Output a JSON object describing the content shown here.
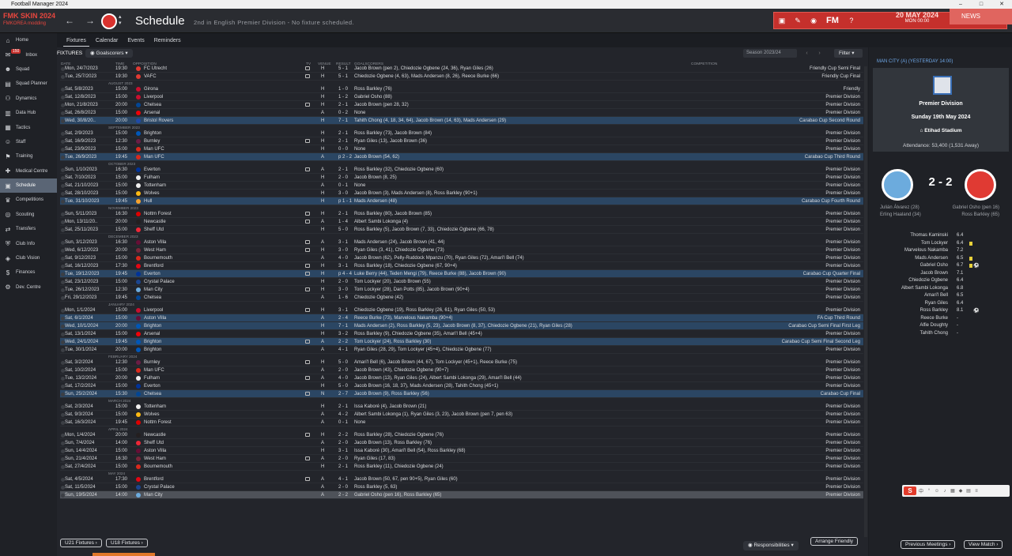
{
  "window": {
    "title": "Football Manager 2024",
    "min": "–",
    "max": "□",
    "close": "✕"
  },
  "topbar": {
    "skin_title": "FMK SKIN 2024",
    "skin_sub": "FMKOREA modding",
    "page_title": "Schedule",
    "page_subtitle": "2nd in English Premier Division - No fixture scheduled.",
    "date": "20 MAY 2024",
    "time": "MON 00:00",
    "news_label": "NEWS",
    "fm_logo": "FM",
    "accent_color": "#c5302c"
  },
  "sidebar": {
    "items": [
      {
        "label": "Home",
        "icon": "home-icon"
      },
      {
        "label": "Inbox",
        "icon": "inbox-icon",
        "badge": "150"
      },
      {
        "label": "Squad",
        "icon": "squad-icon"
      },
      {
        "label": "Squad Planner",
        "icon": "planner-icon"
      },
      {
        "label": "Dynamics",
        "icon": "dynamics-icon"
      },
      {
        "label": "Data Hub",
        "icon": "datahub-icon"
      },
      {
        "label": "Tactics",
        "icon": "tactics-icon"
      },
      {
        "label": "Staff",
        "icon": "staff-icon"
      },
      {
        "label": "Training",
        "icon": "training-icon"
      },
      {
        "label": "Medical Centre",
        "icon": "medical-icon"
      },
      {
        "label": "Schedule",
        "icon": "schedule-icon",
        "active": true
      },
      {
        "label": "Competitions",
        "icon": "competitions-icon"
      },
      {
        "label": "Scouting",
        "icon": "scouting-icon"
      },
      {
        "label": "Transfers",
        "icon": "transfers-icon"
      },
      {
        "label": "Club Info",
        "icon": "clubinfo-icon"
      },
      {
        "label": "Club Vision",
        "icon": "clubvision-icon"
      },
      {
        "label": "Finances",
        "icon": "finances-icon"
      },
      {
        "label": "Dev. Centre",
        "icon": "devcentre-icon"
      }
    ]
  },
  "subtabs": [
    "Fixtures",
    "Calendar",
    "Events",
    "Reminders"
  ],
  "toolbar": {
    "fixtures_label": "FIXTURES",
    "goalscorers": "Goalscorers",
    "season": "Season 2023/24",
    "filter": "Filter"
  },
  "columns": {
    "date": "DATE",
    "time": "TIME",
    "opposition": "OPPOSITION",
    "tv": "TV",
    "venue": "VENUE",
    "result": "RESULT",
    "goalscorers": "GOALSCORERS",
    "competition": "COMPETITION"
  },
  "fixtures": [
    {
      "type": "row",
      "date": "Mon, 24/7/2023",
      "time": "19:30",
      "opp": "FC Utrecht",
      "tv": true,
      "venue": "H",
      "result": "5 - 1",
      "scorers": "Jacob Brown (pen 2), Chiedozie Ogbene (24, 36), Ryan Giles (26)",
      "comp": "Friendly Cup Semi Final",
      "crest": "#e03a33"
    },
    {
      "type": "row",
      "date": "Tue, 25/7/2023",
      "time": "19:30",
      "opp": "VAFC",
      "tv": true,
      "venue": "H",
      "result": "5 - 1",
      "scorers": "Chiedozie Ogbene (4, 63), Mads Andersen (8, 26), Reece Burke (66)",
      "comp": "Friendly Cup Final",
      "crest": "#e03a33"
    },
    {
      "type": "group",
      "label": "AUGUST 2023"
    },
    {
      "type": "row",
      "date": "Sat, 5/8/2023",
      "time": "15:00",
      "opp": "Girona",
      "venue": "H",
      "result": "1 - 0",
      "scorers": "Ross Barkley (76)",
      "comp": "Friendly",
      "crest": "#c8102e"
    },
    {
      "type": "row",
      "date": "Sat, 12/8/2023",
      "time": "15:00",
      "opp": "Liverpool",
      "venue": "H",
      "result": "1 - 2",
      "scorers": "Gabriel Osho (88)",
      "comp": "Premier Division",
      "crest": "#c8102e"
    },
    {
      "type": "row",
      "date": "Mon, 21/8/2023",
      "time": "20:00",
      "opp": "Chelsea",
      "tv": true,
      "venue": "H",
      "result": "2 - 1",
      "scorers": "Jacob Brown (pen 28, 32)",
      "comp": "Premier Division",
      "crest": "#034694"
    },
    {
      "type": "row",
      "date": "Sat, 26/8/2023",
      "time": "15:00",
      "opp": "Arsenal",
      "venue": "A",
      "result": "0 - 2",
      "scorers": "None",
      "comp": "Premier Division",
      "crest": "#ef0107"
    },
    {
      "type": "row",
      "hl": true,
      "date": "Wed, 30/8/20..",
      "time": "20:00",
      "opp": "Bristol Rovers",
      "venue": "H",
      "result": "7 - 1",
      "scorers": "Tahith Chong (4, 18, 34, 64), Jacob Brown (14, 63), Mads Andersen (29)",
      "comp": "Carabao Cup Second Round",
      "crest": "#1f4aa8"
    },
    {
      "type": "group",
      "label": "SEPTEMBER 2023"
    },
    {
      "type": "row",
      "date": "Sat, 2/9/2023",
      "time": "15:00",
      "opp": "Brighton",
      "venue": "H",
      "result": "2 - 1",
      "scorers": "Ross Barkley (73), Jacob Brown (84)",
      "comp": "Premier Division",
      "crest": "#0057b8"
    },
    {
      "type": "row",
      "date": "Sat, 16/9/2023",
      "time": "12:30",
      "opp": "Burnley",
      "tv": true,
      "venue": "H",
      "result": "2 - 1",
      "scorers": "Ryan Giles (13), Jacob Brown (36)",
      "comp": "Premier Division",
      "crest": "#6c1d45"
    },
    {
      "type": "row",
      "date": "Sat, 23/9/2023",
      "time": "15:00",
      "opp": "Man UFC",
      "venue": "H",
      "result": "0 - 0",
      "scorers": "None",
      "comp": "Premier Division",
      "crest": "#da291c"
    },
    {
      "type": "row",
      "hl": true,
      "date": "Tue, 26/9/2023",
      "time": "19:45",
      "opp": "Man UFC",
      "venue": "A",
      "result": "p 2 - 2",
      "scorers": "Jacob Brown (54, 62)",
      "comp": "Carabao Cup Third Round",
      "crest": "#da291c"
    },
    {
      "type": "group",
      "label": "OCTOBER 2023"
    },
    {
      "type": "row",
      "date": "Sun, 1/10/2023",
      "time": "16:30",
      "opp": "Everton",
      "tv": true,
      "venue": "A",
      "result": "2 - 1",
      "scorers": "Ross Barkley (32), Chiedozie Ogbene (60)",
      "comp": "Premier Division",
      "crest": "#003399"
    },
    {
      "type": "row",
      "date": "Sat, 7/10/2023",
      "time": "15:00",
      "opp": "Fulham",
      "venue": "H",
      "result": "2 - 0",
      "scorers": "Jacob Brown (8, 25)",
      "comp": "Premier Division",
      "crest": "#eeeeee"
    },
    {
      "type": "row",
      "date": "Sat, 21/10/2023",
      "time": "15:00",
      "opp": "Tottenham",
      "venue": "A",
      "result": "0 - 1",
      "scorers": "None",
      "comp": "Premier Division",
      "crest": "#f0f0f0"
    },
    {
      "type": "row",
      "date": "Sat, 28/10/2023",
      "time": "15:00",
      "opp": "Wolves",
      "venue": "H",
      "result": "3 - 0",
      "scorers": "Jacob Brown (3), Mads Andersen (8), Ross Barkley (90+1)",
      "comp": "Premier Division",
      "crest": "#fdb913"
    },
    {
      "type": "row",
      "hl": true,
      "date": "Tue, 31/10/2023",
      "time": "19:45",
      "opp": "Hull",
      "venue": "H",
      "result": "p 1 - 1",
      "scorers": "Mads Andersen (48)",
      "comp": "Carabao Cup Fourth Round",
      "crest": "#f5a12d"
    },
    {
      "type": "group",
      "label": "NOVEMBER 2023"
    },
    {
      "type": "row",
      "date": "Sun, 5/11/2023",
      "time": "16:30",
      "opp": "Nottm Forest",
      "tv": true,
      "venue": "H",
      "result": "2 - 1",
      "scorers": "Ross Barkley (80), Jacob Brown (85)",
      "comp": "Premier Division",
      "crest": "#dd0000"
    },
    {
      "type": "row",
      "date": "Mon, 13/11/20..",
      "time": "20:00",
      "opp": "Newcastle",
      "tv": true,
      "venue": "A",
      "result": "1 - 4",
      "scorers": "Albert Sambi Lokonga (4)",
      "comp": "Premier Division",
      "crest": "#241f20"
    },
    {
      "type": "row",
      "date": "Sat, 25/11/2023",
      "time": "15:00",
      "opp": "Sheff Utd",
      "venue": "H",
      "result": "5 - 0",
      "scorers": "Ross Barkley (5), Jacob Brown (7, 33), Chiedozie Ogbene (66, 78)",
      "comp": "Premier Division",
      "crest": "#ee2737"
    },
    {
      "type": "group",
      "label": "DECEMBER 2023"
    },
    {
      "type": "row",
      "date": "Sun, 3/12/2023",
      "time": "16:30",
      "opp": "Aston Villa",
      "tv": true,
      "venue": "A",
      "result": "3 - 1",
      "scorers": "Mads Andersen (24), Jacob Brown (41, 44)",
      "comp": "Premier Division",
      "crest": "#670e36"
    },
    {
      "type": "row",
      "date": "Wed, 6/12/2023",
      "time": "20:00",
      "opp": "West Ham",
      "tv": true,
      "venue": "H",
      "result": "3 - 0",
      "scorers": "Ryan Giles (3, 41), Chiedozie Ogbene (73)",
      "comp": "Premier Division",
      "crest": "#7a263a"
    },
    {
      "type": "row",
      "date": "Sat, 9/12/2023",
      "time": "15:00",
      "opp": "Bournemouth",
      "venue": "A",
      "result": "4 - 0",
      "scorers": "Jacob Brown (62), Pelly-Ruddock Mpanzu (70), Ryan Giles (72), Amari'l Bell (74)",
      "comp": "Premier Division",
      "crest": "#da291c"
    },
    {
      "type": "row",
      "date": "Sat, 16/12/2023",
      "time": "17:30",
      "opp": "Brentford",
      "tv": true,
      "venue": "H",
      "result": "3 - 1",
      "scorers": "Ross Barkley (18), Chiedozie Ogbene (67, 90+4)",
      "comp": "Premier Division",
      "crest": "#e30613"
    },
    {
      "type": "row",
      "hl": true,
      "date": "Tue, 19/12/2023",
      "time": "19:45",
      "opp": "Everton",
      "tv": true,
      "venue": "H",
      "result": "p 4 - 4",
      "scorers": "Luke Berry (44), Teden Mengi (79), Reece Burke (88), Jacob Brown (90)",
      "comp": "Carabao Cup Quarter Final",
      "crest": "#003399"
    },
    {
      "type": "row",
      "date": "Sat, 23/12/2023",
      "time": "15:00",
      "opp": "Crystal Palace",
      "venue": "H",
      "result": "2 - 0",
      "scorers": "Tom Lockyer (20), Jacob Brown (55)",
      "comp": "Premier Division",
      "crest": "#1b458f"
    },
    {
      "type": "row",
      "date": "Tue, 26/12/2023",
      "time": "12:30",
      "opp": "Man City",
      "tv": true,
      "venue": "H",
      "result": "3 - 0",
      "scorers": "Tom Lockyer (28), Dan Potts (85), Jacob Brown (90+4)",
      "comp": "Premier Division",
      "crest": "#6cabdd"
    },
    {
      "type": "row",
      "date": "Fri, 29/12/2023",
      "time": "19:45",
      "opp": "Chelsea",
      "venue": "A",
      "result": "1 - 6",
      "scorers": "Chiedozie Ogbene (42)",
      "comp": "Premier Division",
      "crest": "#034694"
    },
    {
      "type": "group",
      "label": "JANUARY 2024"
    },
    {
      "type": "row",
      "date": "Mon, 1/1/2024",
      "time": "15:00",
      "opp": "Liverpool",
      "tv": true,
      "venue": "H",
      "result": "3 - 1",
      "scorers": "Chiedozie Ogbene (19), Ross Barkley (26, 61), Ryan Giles (50, 53)",
      "comp": "Premier Division",
      "crest": "#c8102e"
    },
    {
      "type": "row",
      "hl": true,
      "date": "Sat, 6/1/2024",
      "time": "15:00",
      "opp": "Aston Villa",
      "venue": "A",
      "result": "2 - 4",
      "scorers": "Reece Burke (73), Marvelous Nakamba (90+4)",
      "comp": "FA Cup Third Round",
      "crest": "#670e36"
    },
    {
      "type": "row",
      "hl": true,
      "date": "Wed, 10/1/2024",
      "time": "20:00",
      "opp": "Brighton",
      "venue": "H",
      "result": "7 - 1",
      "scorers": "Mads Andersen (2), Ross Barkley (5, 23), Jacob Brown (8, 37), Chiedozie Ogbene (21), Ryan Giles (28)",
      "comp": "Carabao Cup Semi Final First Leg",
      "crest": "#0057b8"
    },
    {
      "type": "row",
      "date": "Sat, 13/1/2024",
      "time": "15:00",
      "opp": "Arsenal",
      "venue": "H",
      "result": "3 - 2",
      "scorers": "Ross Barkley (9), Chiedozie Ogbene (35), Amari'l Bell (45+4)",
      "comp": "Premier Division",
      "crest": "#ef0107"
    },
    {
      "type": "row",
      "hl": true,
      "date": "Wed, 24/1/2024",
      "time": "19:45",
      "opp": "Brighton",
      "tv": true,
      "venue": "A",
      "result": "2 - 2",
      "scorers": "Tom Lockyer (24), Ross Barkley (30)",
      "comp": "Carabao Cup Semi Final Second Leg",
      "crest": "#0057b8"
    },
    {
      "type": "row",
      "date": "Tue, 30/1/2024",
      "time": "20:00",
      "opp": "Brighton",
      "venue": "A",
      "result": "4 - 1",
      "scorers": "Ryan Giles (28, 29), Tom Lockyer (45+4), Chiedozie Ogbene (77)",
      "comp": "Premier Division",
      "crest": "#0057b8"
    },
    {
      "type": "group",
      "label": "FEBRUARY 2024"
    },
    {
      "type": "row",
      "date": "Sat, 3/2/2024",
      "time": "12:30",
      "opp": "Burnley",
      "tv": true,
      "venue": "H",
      "result": "5 - 0",
      "scorers": "Amari'l Bell (6), Jacob Brown (44, 67), Tom Lockyer (45+1), Reece Burke (75)",
      "comp": "Premier Division",
      "crest": "#6c1d45"
    },
    {
      "type": "row",
      "date": "Sat, 10/2/2024",
      "time": "15:00",
      "opp": "Man UFC",
      "venue": "A",
      "result": "2 - 0",
      "scorers": "Jacob Brown (43), Chiedozie Ogbene (90+7)",
      "comp": "Premier Division",
      "crest": "#da291c"
    },
    {
      "type": "row",
      "date": "Tue, 13/2/2024",
      "time": "20:00",
      "opp": "Fulham",
      "tv": true,
      "venue": "A",
      "result": "4 - 0",
      "scorers": "Jacob Brown (13), Ryan Giles (24), Albert Sambi Lokonga (29), Amari'l Bell (44)",
      "comp": "Premier Division",
      "crest": "#eeeeee"
    },
    {
      "type": "row",
      "date": "Sat, 17/2/2024",
      "time": "15:00",
      "opp": "Everton",
      "venue": "H",
      "result": "5 - 0",
      "scorers": "Jacob Brown (16, 18, 37), Mads Andersen (28), Tahith Chong (45+1)",
      "comp": "Premier Division",
      "crest": "#003399"
    },
    {
      "type": "row",
      "hl": true,
      "date": "Sun, 25/2/2024",
      "time": "15:30",
      "opp": "Chelsea",
      "tv": true,
      "venue": "N",
      "result": "2 - 7",
      "scorers": "Jacob Brown (9), Ross Barkley (56)",
      "comp": "Carabao Cup Final",
      "crest": "#034694"
    },
    {
      "type": "group",
      "label": "MARCH 2024"
    },
    {
      "type": "row",
      "date": "Sat, 2/3/2024",
      "time": "15:00",
      "opp": "Tottenham",
      "venue": "H",
      "result": "2 - 1",
      "scorers": "Issa Kaboré (4), Jacob Brown (21)",
      "comp": "Premier Division",
      "crest": "#f0f0f0"
    },
    {
      "type": "row",
      "date": "Sat, 9/3/2024",
      "time": "15:00",
      "opp": "Wolves",
      "venue": "A",
      "result": "4 - 2",
      "scorers": "Albert Sambi Lokonga (1), Ryan Giles (3, 23), Jacob Brown (pen 7, pen 63)",
      "comp": "Premier Division",
      "crest": "#fdb913"
    },
    {
      "type": "row",
      "date": "Sat, 16/3/2024",
      "time": "19:45",
      "opp": "Nottm Forest",
      "venue": "A",
      "result": "0 - 1",
      "scorers": "None",
      "comp": "Premier Division",
      "crest": "#dd0000"
    },
    {
      "type": "group",
      "label": "APRIL 2024"
    },
    {
      "type": "row",
      "date": "Mon, 1/4/2024",
      "time": "20:00",
      "opp": "Newcastle",
      "tv": true,
      "venue": "H",
      "result": "2 - 2",
      "scorers": "Ross Barkley (28), Chiedozie Ogbene (76)",
      "comp": "Premier Division",
      "crest": "#241f20"
    },
    {
      "type": "row",
      "date": "Sun, 7/4/2024",
      "time": "14:00",
      "opp": "Sheff Utd",
      "venue": "A",
      "result": "2 - 0",
      "scorers": "Jacob Brown (13), Ross Barkley (76)",
      "comp": "Premier Division",
      "crest": "#ee2737"
    },
    {
      "type": "row",
      "date": "Sun, 14/4/2024",
      "time": "15:00",
      "opp": "Aston Villa",
      "venue": "H",
      "result": "3 - 1",
      "scorers": "Issa Kaboré (30), Amari'l Bell (54), Ross Barkley (68)",
      "comp": "Premier Division",
      "crest": "#670e36"
    },
    {
      "type": "row",
      "date": "Sun, 21/4/2024",
      "time": "16:30",
      "opp": "West Ham",
      "tv": true,
      "venue": "A",
      "result": "2 - 0",
      "scorers": "Ryan Giles (17, 83)",
      "comp": "Premier Division",
      "crest": "#7a263a"
    },
    {
      "type": "row",
      "date": "Sat, 27/4/2024",
      "time": "15:00",
      "opp": "Bournemouth",
      "venue": "H",
      "result": "2 - 1",
      "scorers": "Ross Barkley (11), Chiedozie Ogbene (24)",
      "comp": "Premier Division",
      "crest": "#da291c"
    },
    {
      "type": "group",
      "label": "MAY 2024"
    },
    {
      "type": "row",
      "date": "Sat, 4/5/2024",
      "time": "17:30",
      "opp": "Brentford",
      "tv": true,
      "venue": "A",
      "result": "4 - 1",
      "scorers": "Jacob Brown (50, 67, pen 90+5), Ryan Giles (60)",
      "comp": "Premier Division",
      "crest": "#e30613"
    },
    {
      "type": "row",
      "date": "Sat, 11/5/2024",
      "time": "15:00",
      "opp": "Crystal Palace",
      "venue": "A",
      "result": "2 - 0",
      "scorers": "Ross Barkley (5, 63)",
      "comp": "Premier Division",
      "crest": "#1b458f"
    },
    {
      "type": "row",
      "today": true,
      "date": "Sun, 19/5/2024",
      "time": "14:00",
      "opp": "Man City",
      "venue": "A",
      "result": "2 - 2",
      "scorers": "Gabriel Osho (pen 16), Ross Barkley (65)",
      "comp": "Premier Division",
      "crest": "#6cabdd"
    }
  ],
  "bottom": {
    "u21": "U21 Fixtures",
    "u18": "U18 Fixtures",
    "responsibilities": "Responsibilities",
    "arrange": "Arrange Friendly"
  },
  "match_panel": {
    "header": "MAN CITY (A) (YESTERDAY 14:00)",
    "competition": "Premier Division",
    "date": "Sunday 19th May 2024",
    "venue": "Etihad Stadium",
    "attendance": "Attendance: 53,400 (1,531 Away)",
    "score": "2 - 2",
    "home_scorers": [
      "Julián Álvarez (28)",
      "Erling Haaland (34)"
    ],
    "away_scorers": [
      "Gabriel Osho (pen 16)",
      "Ross Barkley (65)"
    ],
    "ratings": [
      {
        "name": "Thomas Kaminski",
        "rating": "6.4"
      },
      {
        "name": "Tom Lockyer",
        "rating": "6.4",
        "yellow": true
      },
      {
        "name": "Marvelous Nakamba",
        "rating": "7.2"
      },
      {
        "name": "Mads Andersen",
        "rating": "6.5",
        "yellow": true
      },
      {
        "name": "Gabriel Osho",
        "rating": "6.7",
        "yellow": true,
        "goal": true
      },
      {
        "name": "Jacob Brown",
        "rating": "7.1"
      },
      {
        "name": "Chiedozie Ogbene",
        "rating": "6.4"
      },
      {
        "name": "Albert Sambi Lokonga",
        "rating": "6.8"
      },
      {
        "name": "Amari'l Bell",
        "rating": "6.5"
      },
      {
        "name": "Ryan Giles",
        "rating": "6.4"
      },
      {
        "name": "Ross Barkley",
        "rating": "8.1",
        "goal": true
      },
      {
        "name": "Reece Burke",
        "rating": "-"
      },
      {
        "name": "Alfie Doughty",
        "rating": "-"
      },
      {
        "name": "Tahith Chong",
        "rating": "-"
      }
    ],
    "prev_meetings": "Previous Meetings",
    "view_match": "View Match"
  }
}
